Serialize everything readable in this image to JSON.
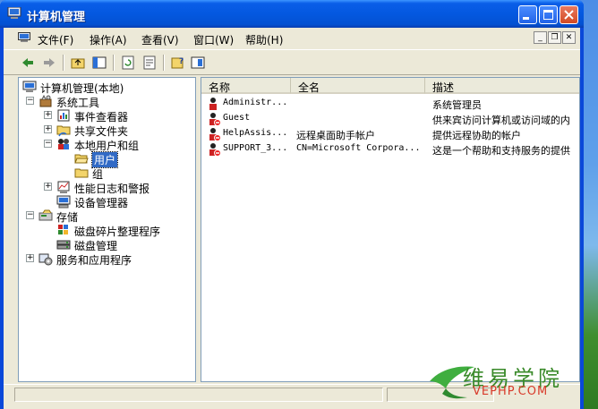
{
  "window": {
    "title": "计算机管理"
  },
  "menu": {
    "items": [
      {
        "name": "file",
        "label": "文件(F)"
      },
      {
        "name": "action",
        "label": "操作(A)"
      },
      {
        "name": "view",
        "label": "查看(V)"
      },
      {
        "name": "window",
        "label": "窗口(W)"
      },
      {
        "name": "help",
        "label": "帮助(H)"
      }
    ]
  },
  "tree": {
    "root": "计算机管理(本地)",
    "system_tools": "系统工具",
    "event_viewer": "事件查看器",
    "shared_folders": "共享文件夹",
    "local_users_groups": "本地用户和组",
    "users": "用户",
    "groups": "组",
    "perf_logs": "性能日志和警报",
    "device_manager": "设备管理器",
    "storage": "存储",
    "defrag": "磁盘碎片整理程序",
    "disk_mgmt": "磁盘管理",
    "services_apps": "服务和应用程序"
  },
  "list": {
    "headers": {
      "name": "名称",
      "fullname": "全名",
      "desc": "描述"
    },
    "rows": [
      {
        "name": "Administr...",
        "fullname": "",
        "desc": "系统管理员"
      },
      {
        "name": "Guest",
        "fullname": "",
        "desc": "供来宾访问计算机或访问域的内"
      },
      {
        "name": "HelpAssis...",
        "fullname": "远程桌面助手帐户",
        "desc": "提供远程协助的帐户"
      },
      {
        "name": "SUPPORT_3...",
        "fullname": "CN=Microsoft Corpora...",
        "desc": "这是一个帮助和支持服务的提供"
      }
    ]
  },
  "watermark": {
    "text": "维易学院",
    "sub": "VEPHP.COM"
  },
  "colors": {
    "title_blue": "#0458e0",
    "selection": "#316ac5",
    "face": "#ece9d8"
  }
}
